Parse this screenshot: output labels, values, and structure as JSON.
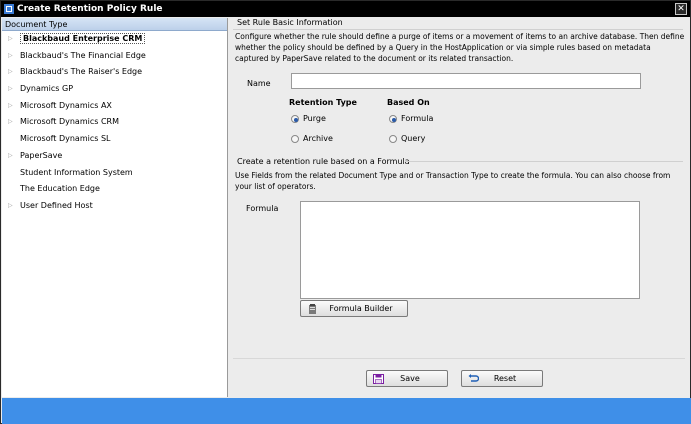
{
  "window": {
    "title": "Create Retention Policy Rule",
    "close_glyph": "✕"
  },
  "tree": {
    "header": "Document Type",
    "items": [
      {
        "label": "Blackbaud Enterprise CRM",
        "expandable": true,
        "selected": true
      },
      {
        "label": "Blackbaud's The Financial Edge",
        "expandable": true,
        "selected": false
      },
      {
        "label": "Blackbaud's The Raiser's Edge",
        "expandable": true,
        "selected": false
      },
      {
        "label": "Dynamics GP",
        "expandable": true,
        "selected": false
      },
      {
        "label": "Microsoft Dynamics AX",
        "expandable": true,
        "selected": false
      },
      {
        "label": "Microsoft Dynamics CRM",
        "expandable": true,
        "selected": false
      },
      {
        "label": "Microsoft Dynamics SL",
        "expandable": false,
        "selected": false
      },
      {
        "label": "PaperSave",
        "expandable": true,
        "selected": false
      },
      {
        "label": "Student Information System",
        "expandable": false,
        "selected": false
      },
      {
        "label": "The Education Edge",
        "expandable": false,
        "selected": false
      },
      {
        "label": "User Defined Host",
        "expandable": true,
        "selected": false
      }
    ]
  },
  "basic": {
    "section_title": "Set Rule Basic Information",
    "description": "Configure whether the rule should define a purge of items or a movement of items to an archive database. Then define whether the policy should be defined by a Query in the HostApplication or via simple rules based on metadata captured by PaperSave related to the document or its related transaction.",
    "name_label": "Name",
    "name_value": "",
    "retention_type_label": "Retention Type",
    "retention_options": [
      "Purge",
      "Archive"
    ],
    "retention_selected": "Purge",
    "based_on_label": "Based On",
    "based_on_options": [
      "Formula",
      "Query"
    ],
    "based_on_selected": "Formula"
  },
  "formula": {
    "section_title": "Create a retention rule based on a Formula",
    "description": "Use Fields from the related Document Type and or Transaction Type to create the formula. You can also choose from your list of operators.",
    "formula_label": "Formula",
    "formula_value": "",
    "builder_button": "Formula Builder"
  },
  "actions": {
    "save": "Save",
    "reset": "Reset"
  },
  "colors": {
    "titlebar": "#000000",
    "status_bar": "#3f8fe8",
    "tree_header": "#c8daf0",
    "panel": "#ececec"
  },
  "icons": {
    "app": "app-window-icon",
    "expander": "triangle-right-icon",
    "radio": "radio-dot-icon",
    "builder": "clipboard-icon",
    "save": "floppy-disk-icon",
    "reset": "undo-arrow-icon"
  }
}
